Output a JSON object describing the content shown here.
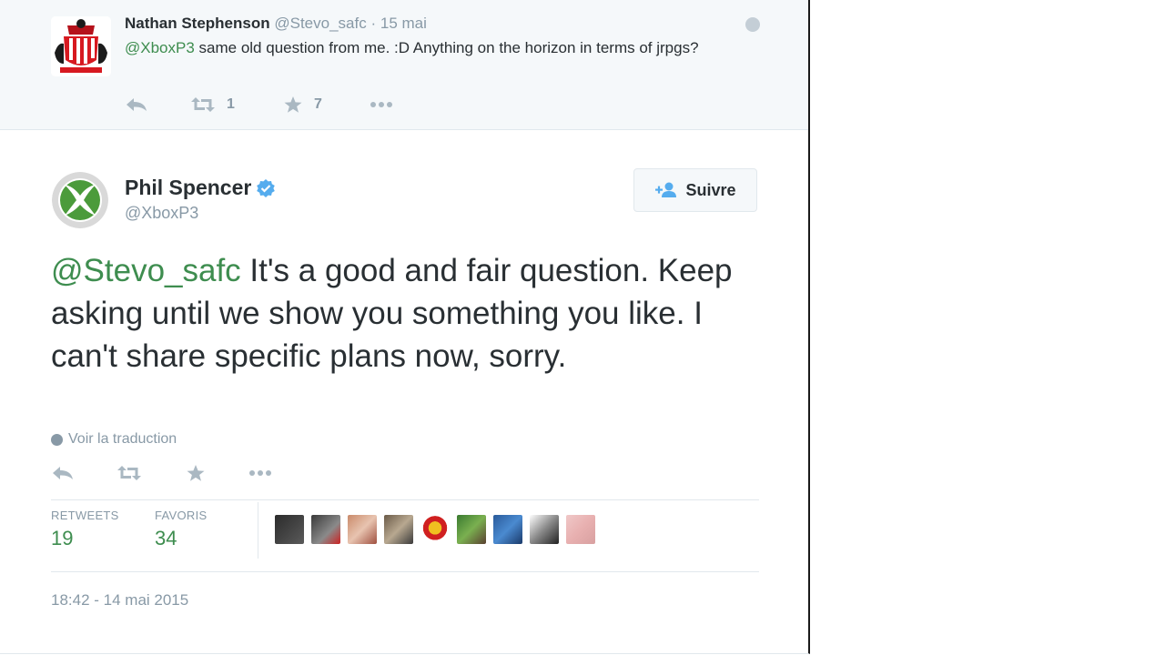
{
  "parent_tweet": {
    "fullname": "Nathan Stephenson",
    "username": "@Stevo_safc",
    "separator": "·",
    "timestamp": "15 mai",
    "mention": "@XboxP3",
    "text": " same old question from me. :D Anything on the horizon in terms of jrpgs?",
    "retweet_count": "1",
    "favorite_count": "7"
  },
  "main_tweet": {
    "fullname": "Phil Spencer",
    "username": "@XboxP3",
    "follow_label": "Suivre",
    "mention": "@Stevo_safc",
    "text": " It's a good and fair question. Keep asking until we show you something you like. I can't share specific plans now, sorry.",
    "translate_label": "Voir la traduction",
    "stats": {
      "retweets_label": "RETWEETS",
      "retweets_value": "19",
      "favorites_label": "FAVORIS",
      "favorites_value": "34"
    },
    "timestamp": "18:42 - 14 mai 2015"
  },
  "icons": [
    "reply-icon",
    "retweet-icon",
    "favorite-icon",
    "more-icon",
    "globe-icon",
    "verified-icon",
    "follow-icon"
  ],
  "colors": {
    "accent_link": "#3e8d4f",
    "muted_text": "#8899a6",
    "icon_gray": "#aab8c2",
    "verified_blue": "#55acee",
    "parent_bg": "#f5f8fa"
  }
}
